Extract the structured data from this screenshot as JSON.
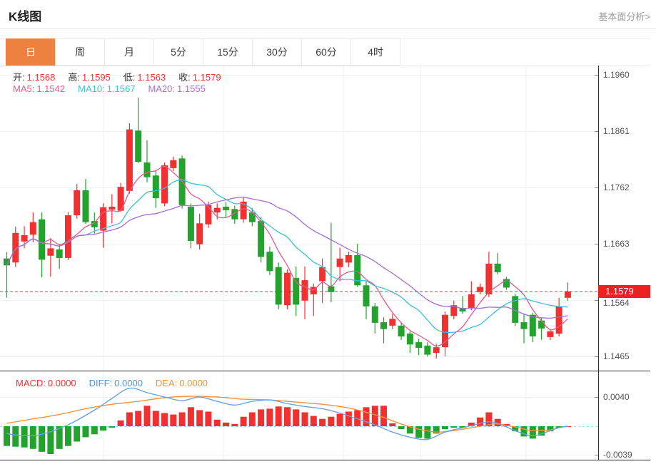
{
  "header": {
    "title": "K线图",
    "link": "基本面分析>"
  },
  "tabs": {
    "items": [
      {
        "label": "日",
        "active": true
      },
      {
        "label": "周",
        "active": false
      },
      {
        "label": "月",
        "active": false
      },
      {
        "label": "5分",
        "active": false
      },
      {
        "label": "15分",
        "active": false
      },
      {
        "label": "30分",
        "active": false
      },
      {
        "label": "60分",
        "active": false
      },
      {
        "label": "4时",
        "active": false
      }
    ]
  },
  "legend": {
    "ohlc": [
      {
        "label": "开:",
        "value": "1.1568"
      },
      {
        "label": "高:",
        "value": "1.1595"
      },
      {
        "label": "低:",
        "value": "1.1563"
      },
      {
        "label": "收:",
        "value": "1.1579"
      }
    ],
    "ohlc_value_color": "#ef3333",
    "ma": [
      {
        "label": "MA5:",
        "value": "1.1542",
        "color": "#e85889"
      },
      {
        "label": "MA10:",
        "value": "1.1567",
        "color": "#38c2d8"
      },
      {
        "label": "MA20:",
        "value": "1.1555",
        "color": "#a86cd5"
      }
    ],
    "macd": [
      {
        "label": "MACD:",
        "value": "0.0000",
        "color": "#ef3333"
      },
      {
        "label": "DIFF:",
        "value": "0.0000",
        "color": "#5592dd"
      },
      {
        "label": "DEA:",
        "value": "0.0000",
        "color": "#f2933e"
      }
    ]
  },
  "price_badge": {
    "value": "1.1579",
    "color": "#ee2020"
  },
  "colors": {
    "up": "#f23030",
    "down": "#23a22d",
    "ma5": "#e85889",
    "ma10": "#38c2d8",
    "ma20": "#a86cd5",
    "diff": "#6aa3e0",
    "dea": "#f2933e",
    "grid": "#f0f0f0",
    "vgrid": "#f2f2f2",
    "axis": "#333333",
    "zero_dash": "#a7d7e8",
    "price_dash": "#f03030",
    "tick_text": "#555555",
    "tab_active": "#ec8140"
  },
  "chart_data": {
    "type": "candlestick+macd",
    "main": {
      "y_ticks": [
        "1.1960",
        "1.1861",
        "1.1762",
        "1.1663",
        "1.1564",
        "1.1465"
      ],
      "price_line": "1.1579",
      "ma_periods": [
        5,
        10,
        20
      ],
      "candles": [
        [
          1.1637,
          1.1648,
          1.1568,
          1.1625
        ],
        [
          1.163,
          1.1693,
          1.1622,
          1.1682
        ],
        [
          1.1667,
          1.1694,
          1.1655,
          1.1678
        ],
        [
          1.1679,
          1.1718,
          1.1666,
          1.1701
        ],
        [
          1.1706,
          1.1718,
          1.1604,
          1.1635
        ],
        [
          1.1642,
          1.1673,
          1.1605,
          1.1655
        ],
        [
          1.1653,
          1.1663,
          1.1619,
          1.1638
        ],
        [
          1.1638,
          1.1719,
          1.1634,
          1.1713
        ],
        [
          1.1713,
          1.1768,
          1.1707,
          1.1757
        ],
        [
          1.1757,
          1.1777,
          1.1698,
          1.1701
        ],
        [
          1.1703,
          1.1718,
          1.1681,
          1.1692
        ],
        [
          1.1686,
          1.1734,
          1.1656,
          1.1727
        ],
        [
          1.1723,
          1.175,
          1.1699,
          1.1728
        ],
        [
          1.1721,
          1.177,
          1.1719,
          1.1763
        ],
        [
          1.1756,
          1.1875,
          1.1751,
          1.1864
        ],
        [
          1.1862,
          1.192,
          1.1805,
          1.1807
        ],
        [
          1.1806,
          1.1845,
          1.1771,
          1.178
        ],
        [
          1.1783,
          1.1791,
          1.1726,
          1.1743
        ],
        [
          1.1734,
          1.1806,
          1.1729,
          1.1801
        ],
        [
          1.1796,
          1.1816,
          1.1791,
          1.181
        ],
        [
          1.1813,
          1.1818,
          1.1725,
          1.1731
        ],
        [
          1.1728,
          1.1734,
          1.1655,
          1.1668
        ],
        [
          1.1662,
          1.1716,
          1.1653,
          1.1699
        ],
        [
          1.1697,
          1.1737,
          1.1691,
          1.1731
        ],
        [
          1.1718,
          1.1734,
          1.1706,
          1.1726
        ],
        [
          1.1728,
          1.1736,
          1.1708,
          1.1722
        ],
        [
          1.1724,
          1.173,
          1.1698,
          1.1706
        ],
        [
          1.1706,
          1.1744,
          1.17,
          1.1737
        ],
        [
          1.1718,
          1.1726,
          1.1694,
          1.1701
        ],
        [
          1.1703,
          1.171,
          1.163,
          1.164
        ],
        [
          1.1649,
          1.1658,
          1.1608,
          1.1615
        ],
        [
          1.1622,
          1.163,
          1.1548,
          1.1556
        ],
        [
          1.1555,
          1.1618,
          1.1548,
          1.1612
        ],
        [
          1.1603,
          1.1623,
          1.1536,
          1.1556
        ],
        [
          1.1563,
          1.1623,
          1.153,
          1.1599
        ],
        [
          1.1574,
          1.1593,
          1.1536,
          1.1587
        ],
        [
          1.1597,
          1.1637,
          1.1559,
          1.1622
        ],
        [
          1.1588,
          1.17,
          1.156,
          1.1578
        ],
        [
          1.1622,
          1.1656,
          1.1597,
          1.1637
        ],
        [
          1.163,
          1.1649,
          1.1622,
          1.1643
        ],
        [
          1.1643,
          1.1663,
          1.1587,
          1.159
        ],
        [
          1.159,
          1.1597,
          1.153,
          1.1553
        ],
        [
          1.1553,
          1.1559,
          1.1505,
          1.1524
        ],
        [
          1.1525,
          1.1534,
          1.1488,
          1.1513
        ],
        [
          1.1519,
          1.154,
          1.1513,
          1.1531
        ],
        [
          1.1519,
          1.1525,
          1.1494,
          1.15
        ],
        [
          1.1505,
          1.1509,
          1.1471,
          1.1486
        ],
        [
          1.149,
          1.1496,
          1.1467,
          1.148
        ],
        [
          1.1484,
          1.149,
          1.1465,
          1.1468
        ],
        [
          1.1471,
          1.1487,
          1.1461,
          1.1481
        ],
        [
          1.1481,
          1.1544,
          1.1465,
          1.1538
        ],
        [
          1.1536,
          1.1563,
          1.153,
          1.1555
        ],
        [
          1.155,
          1.1571,
          1.154,
          1.1544
        ],
        [
          1.155,
          1.1597,
          1.1546,
          1.1574
        ],
        [
          1.1578,
          1.1593,
          1.1574,
          1.1587
        ],
        [
          1.1574,
          1.1649,
          1.1569,
          1.1628
        ],
        [
          1.1628,
          1.1647,
          1.1609,
          1.1613
        ],
        [
          1.1601,
          1.1605,
          1.1582,
          1.1586
        ],
        [
          1.1571,
          1.1575,
          1.1518,
          1.1524
        ],
        [
          1.1525,
          1.154,
          1.1488,
          1.1513
        ],
        [
          1.1538,
          1.1542,
          1.149,
          1.15
        ],
        [
          1.1528,
          1.1532,
          1.1494,
          1.1514
        ],
        [
          1.1499,
          1.1513,
          1.1494,
          1.1509
        ],
        [
          1.1505,
          1.1568,
          1.15,
          1.1553
        ],
        [
          1.1568,
          1.1595,
          1.1563,
          1.1579
        ]
      ]
    },
    "macd": {
      "y_ticks": [
        "0.0040",
        "-0.0039"
      ],
      "hist": [
        -0.0027,
        -0.0028,
        -0.0029,
        -0.0031,
        -0.0035,
        -0.0038,
        -0.0031,
        -0.0027,
        -0.0021,
        -0.0015,
        -0.0011,
        -0.0006,
        -0.0002,
        0.0008,
        0.0019,
        0.0021,
        0.0028,
        0.0021,
        0.0018,
        0.0016,
        0.0019,
        0.0026,
        0.0022,
        0.002,
        0.0009,
        0.0005,
        0.0003,
        0.0013,
        0.0019,
        0.0023,
        0.0024,
        0.0027,
        0.0026,
        0.0023,
        0.0019,
        0.0014,
        0.001,
        0.0013,
        0.0017,
        0.002,
        0.0022,
        0.0026,
        0.0028,
        0.0028,
        0.0004,
        -0.0004,
        -0.001,
        -0.0016,
        -0.0017,
        -0.001,
        -0.0004,
        -0.0002,
        -0.0002,
        0.0005,
        0.0012,
        0.0019,
        0.001,
        0.0003,
        -0.0007,
        -0.0014,
        -0.0017,
        -0.0013,
        -0.0007,
        -0.0002,
        0.0
      ],
      "diff": [
        [
          0,
          -0.001
        ],
        [
          2,
          -0.0013
        ],
        [
          4,
          -0.0011
        ],
        [
          7,
          0.0002
        ],
        [
          10,
          0.0022
        ],
        [
          12,
          0.0038
        ],
        [
          14,
          0.0052
        ],
        [
          16,
          0.0046
        ],
        [
          18,
          0.004
        ],
        [
          20,
          0.0035
        ],
        [
          22,
          0.004
        ],
        [
          24,
          0.0034
        ],
        [
          26,
          0.0029
        ],
        [
          28,
          0.0034
        ],
        [
          30,
          0.0036
        ],
        [
          32,
          0.0031
        ],
        [
          34,
          0.0027
        ],
        [
          36,
          0.0024
        ],
        [
          38,
          0.0018
        ],
        [
          40,
          0.001
        ],
        [
          42,
          0.0002
        ],
        [
          44,
          -0.0008
        ],
        [
          46,
          -0.0015
        ],
        [
          48,
          -0.0018
        ],
        [
          50,
          -0.0008
        ],
        [
          52,
          -0.0002
        ],
        [
          54,
          0.0004
        ],
        [
          55,
          0.0006
        ],
        [
          56,
          0.0004
        ],
        [
          58,
          -0.0006
        ],
        [
          60,
          -0.0013
        ],
        [
          62,
          -0.0006
        ],
        [
          63,
          -0.0002
        ],
        [
          64,
          0.0
        ]
      ],
      "dea": [
        [
          0,
          0.0004
        ],
        [
          3,
          0.001
        ],
        [
          6,
          0.0016
        ],
        [
          9,
          0.0024
        ],
        [
          12,
          0.003
        ],
        [
          15,
          0.0034
        ],
        [
          18,
          0.0039
        ],
        [
          21,
          0.0041
        ],
        [
          24,
          0.004
        ],
        [
          27,
          0.0037
        ],
        [
          30,
          0.0036
        ],
        [
          33,
          0.0033
        ],
        [
          36,
          0.003
        ],
        [
          39,
          0.0025
        ],
        [
          41,
          0.0019
        ],
        [
          43,
          0.0012
        ],
        [
          45,
          0.0003
        ],
        [
          47,
          -0.0004
        ],
        [
          49,
          -0.0008
        ],
        [
          51,
          -0.0006
        ],
        [
          53,
          -0.0002
        ],
        [
          55,
          0.0002
        ],
        [
          56,
          0.0003
        ],
        [
          58,
          -0.0001
        ],
        [
          60,
          -0.0006
        ],
        [
          62,
          -0.0005
        ],
        [
          63,
          -0.0002
        ],
        [
          64,
          0.0
        ]
      ]
    }
  }
}
